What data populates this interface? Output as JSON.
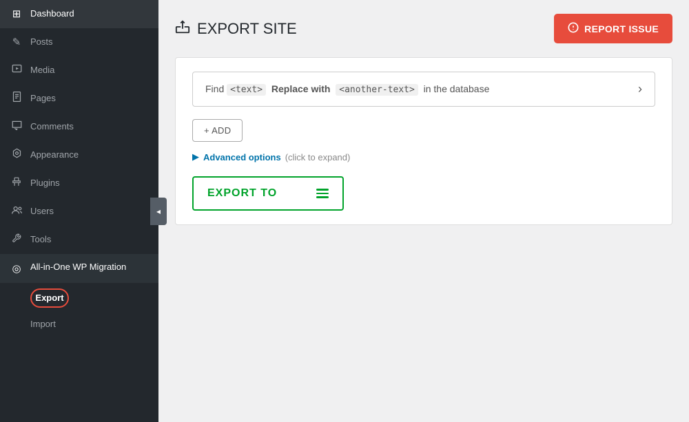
{
  "sidebar": {
    "items": [
      {
        "id": "dashboard",
        "label": "Dashboard",
        "icon": "⊞"
      },
      {
        "id": "posts",
        "label": "Posts",
        "icon": "✎"
      },
      {
        "id": "media",
        "label": "Media",
        "icon": "🖼"
      },
      {
        "id": "pages",
        "label": "Pages",
        "icon": "📄"
      },
      {
        "id": "comments",
        "label": "Comments",
        "icon": "💬"
      },
      {
        "id": "appearance",
        "label": "Appearance",
        "icon": "🎨"
      },
      {
        "id": "plugins",
        "label": "Plugins",
        "icon": "🔌"
      },
      {
        "id": "users",
        "label": "Users",
        "icon": "👤"
      },
      {
        "id": "tools",
        "label": "Tools",
        "icon": "🔧"
      },
      {
        "id": "allinone",
        "label": "All-in-One WP Migration",
        "icon": "◎"
      }
    ],
    "submenu": [
      {
        "id": "export",
        "label": "Export",
        "active": true
      },
      {
        "id": "import",
        "label": "Import",
        "active": false
      }
    ]
  },
  "header": {
    "title": "EXPORT SITE",
    "report_issue_label": "REPORT ISSUE"
  },
  "find_replace": {
    "prefix": "Find",
    "text_placeholder": "<text>",
    "middle": "Replace with",
    "another_placeholder": "<another-text>",
    "suffix": "in the database"
  },
  "add_button": {
    "label": "+ ADD"
  },
  "advanced_options": {
    "label": "Advanced options",
    "hint": "(click to expand)"
  },
  "export_to": {
    "label": "EXPORT TO"
  },
  "colors": {
    "report_issue_bg": "#e74c3c",
    "export_to_border": "#00a32a",
    "sidebar_bg": "#23282d",
    "active_item_bg": "#1e1e1e",
    "export_circle_border": "#e74c3c",
    "link_color": "#0073aa"
  }
}
